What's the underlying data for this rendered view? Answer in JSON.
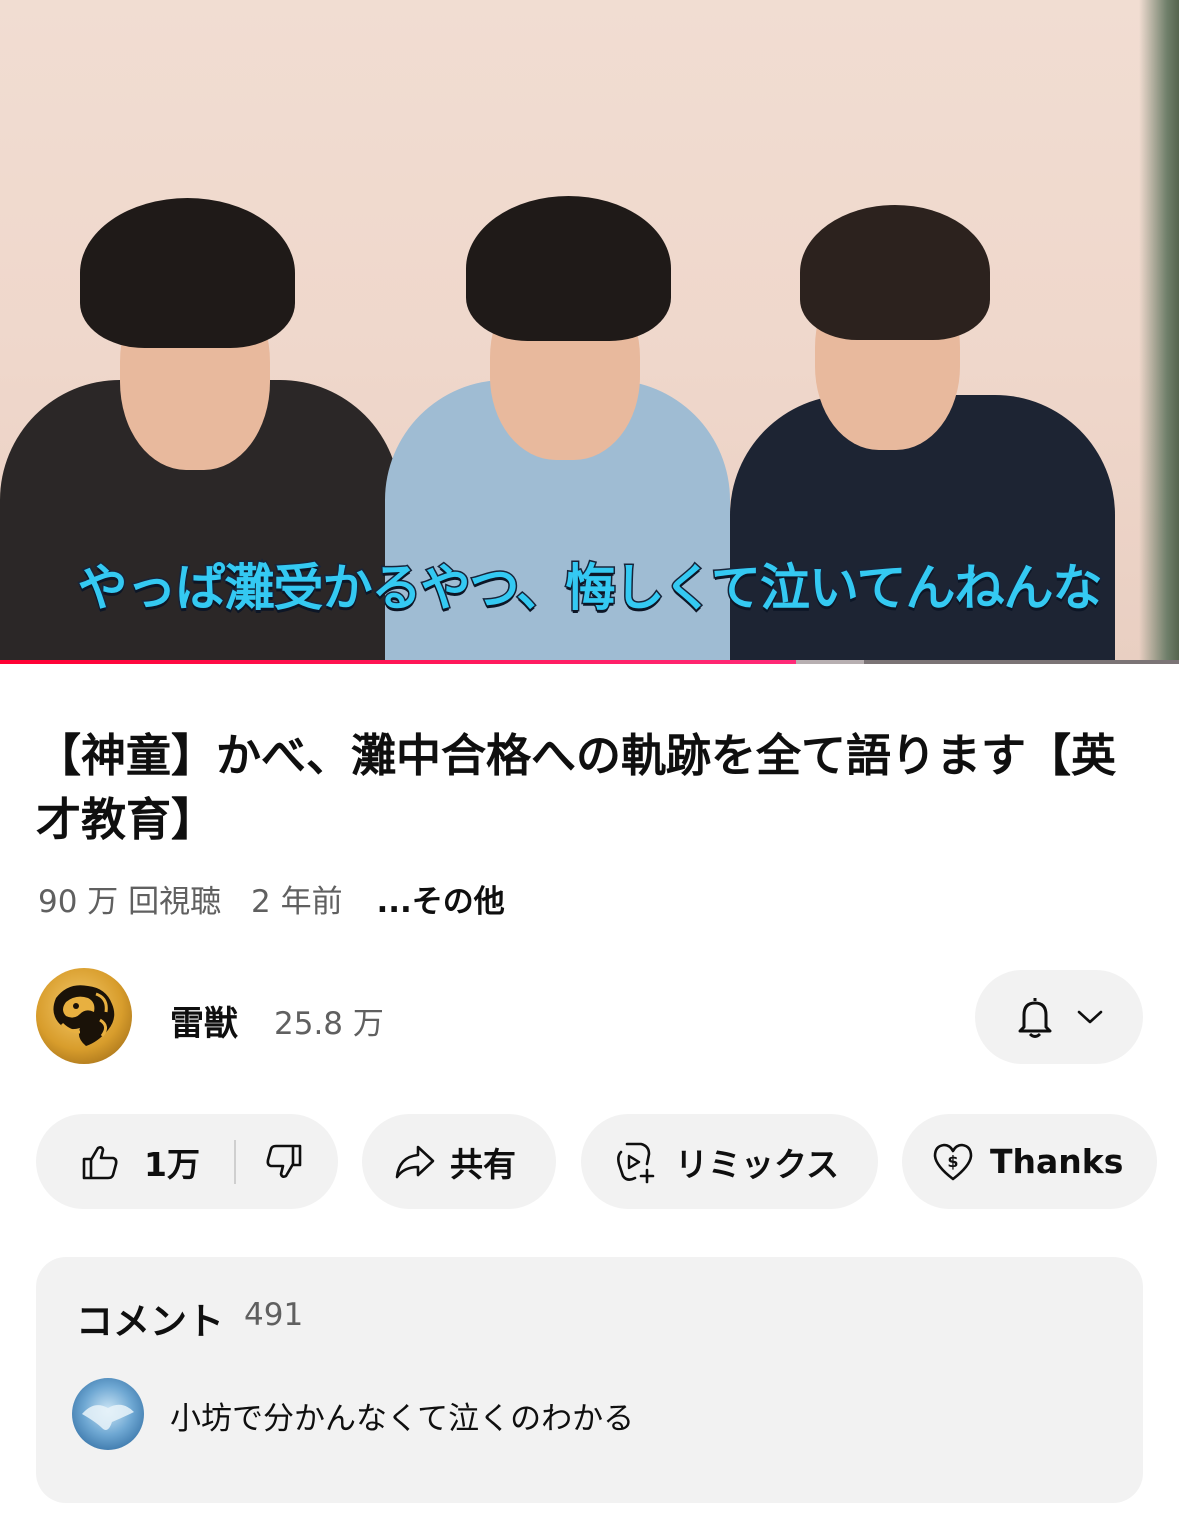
{
  "video": {
    "subtitle": "やっぱ灘受かるやつ、悔しくて泣いてんねんな",
    "progress_fraction": 0.675,
    "buffer_fraction": 0.733
  },
  "title": "【神童】かべ、灘中合格への軌跡を全て語ります【英才教育】",
  "meta": {
    "views": "90 万 回視聴",
    "age": "2 年前",
    "more": "...その他"
  },
  "channel": {
    "name": "雷獣",
    "subscribers": "25.8 万",
    "avatar_icon": "lion-logo-icon",
    "bell_icon": "bell-icon",
    "dropdown_icon": "chevron-down-icon"
  },
  "actions": {
    "like_count": "1万",
    "share_label": "共有",
    "remix_label": "リミックス",
    "thanks_label": "Thanks"
  },
  "comments": {
    "label": "コメント",
    "count": "491",
    "top_comment": "小坊で分かんなくて泣くのわかる"
  },
  "colors": {
    "progress": "#ff0033",
    "subtitle_fill": "#34c9f2",
    "subtitle_stroke": "#17243a",
    "pill_bg": "#f2f2f2",
    "secondary_text": "#606060"
  }
}
